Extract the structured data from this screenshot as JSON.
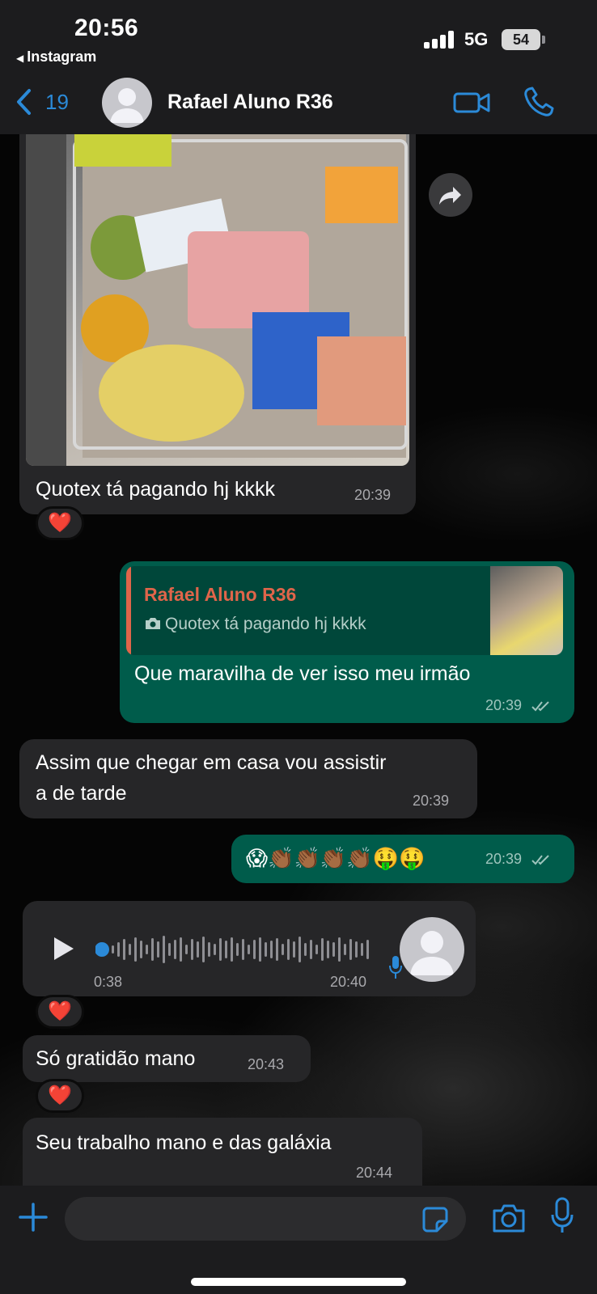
{
  "status_bar": {
    "time": "20:56",
    "back_app": "Instagram",
    "network": "5G",
    "battery": "54"
  },
  "header": {
    "back_count": "19",
    "contact_name": "Rafael Aluno R36"
  },
  "messages": [
    {
      "direction": "incoming",
      "type": "image",
      "caption": "Quotex tá pagando hj kkkk",
      "time": "20:39",
      "reaction": "❤️"
    },
    {
      "direction": "outgoing",
      "type": "reply",
      "quote_author": "Rafael Aluno R36",
      "quote_text": "Quotex tá pagando hj kkkk",
      "text": "Que maravilha de ver isso meu irmão",
      "time": "20:39",
      "status": "read"
    },
    {
      "direction": "incoming",
      "type": "text",
      "text_line1": "Assim que chegar em casa vou assistir",
      "text_line2": "a de tarde",
      "time": "20:39"
    },
    {
      "direction": "outgoing",
      "type": "emoji",
      "text": "😱👏🏾👏🏾👏🏾👏🏾🤑🤑",
      "time": "20:39",
      "status": "read"
    },
    {
      "direction": "incoming",
      "type": "audio",
      "duration": "0:38",
      "time": "20:40",
      "reaction": "❤️"
    },
    {
      "direction": "incoming",
      "type": "text",
      "text": "Só gratidão mano",
      "time": "20:43",
      "reaction": "❤️"
    },
    {
      "direction": "incoming",
      "type": "text",
      "text": "Seu trabalho mano e das galáxia",
      "time": "20:44"
    }
  ],
  "icons": {
    "back": "chevron-left-icon",
    "video": "video-camera-icon",
    "call": "phone-icon",
    "forward": "forward-arrow-icon",
    "attach": "plus-icon",
    "sticker": "sticker-icon",
    "camera": "camera-icon",
    "mic": "microphone-icon"
  },
  "colors": {
    "accent": "#2b8ad8",
    "incoming_bubble": "#262628",
    "outgoing_bubble": "#005c4b",
    "quote_author": "#e0654a"
  }
}
